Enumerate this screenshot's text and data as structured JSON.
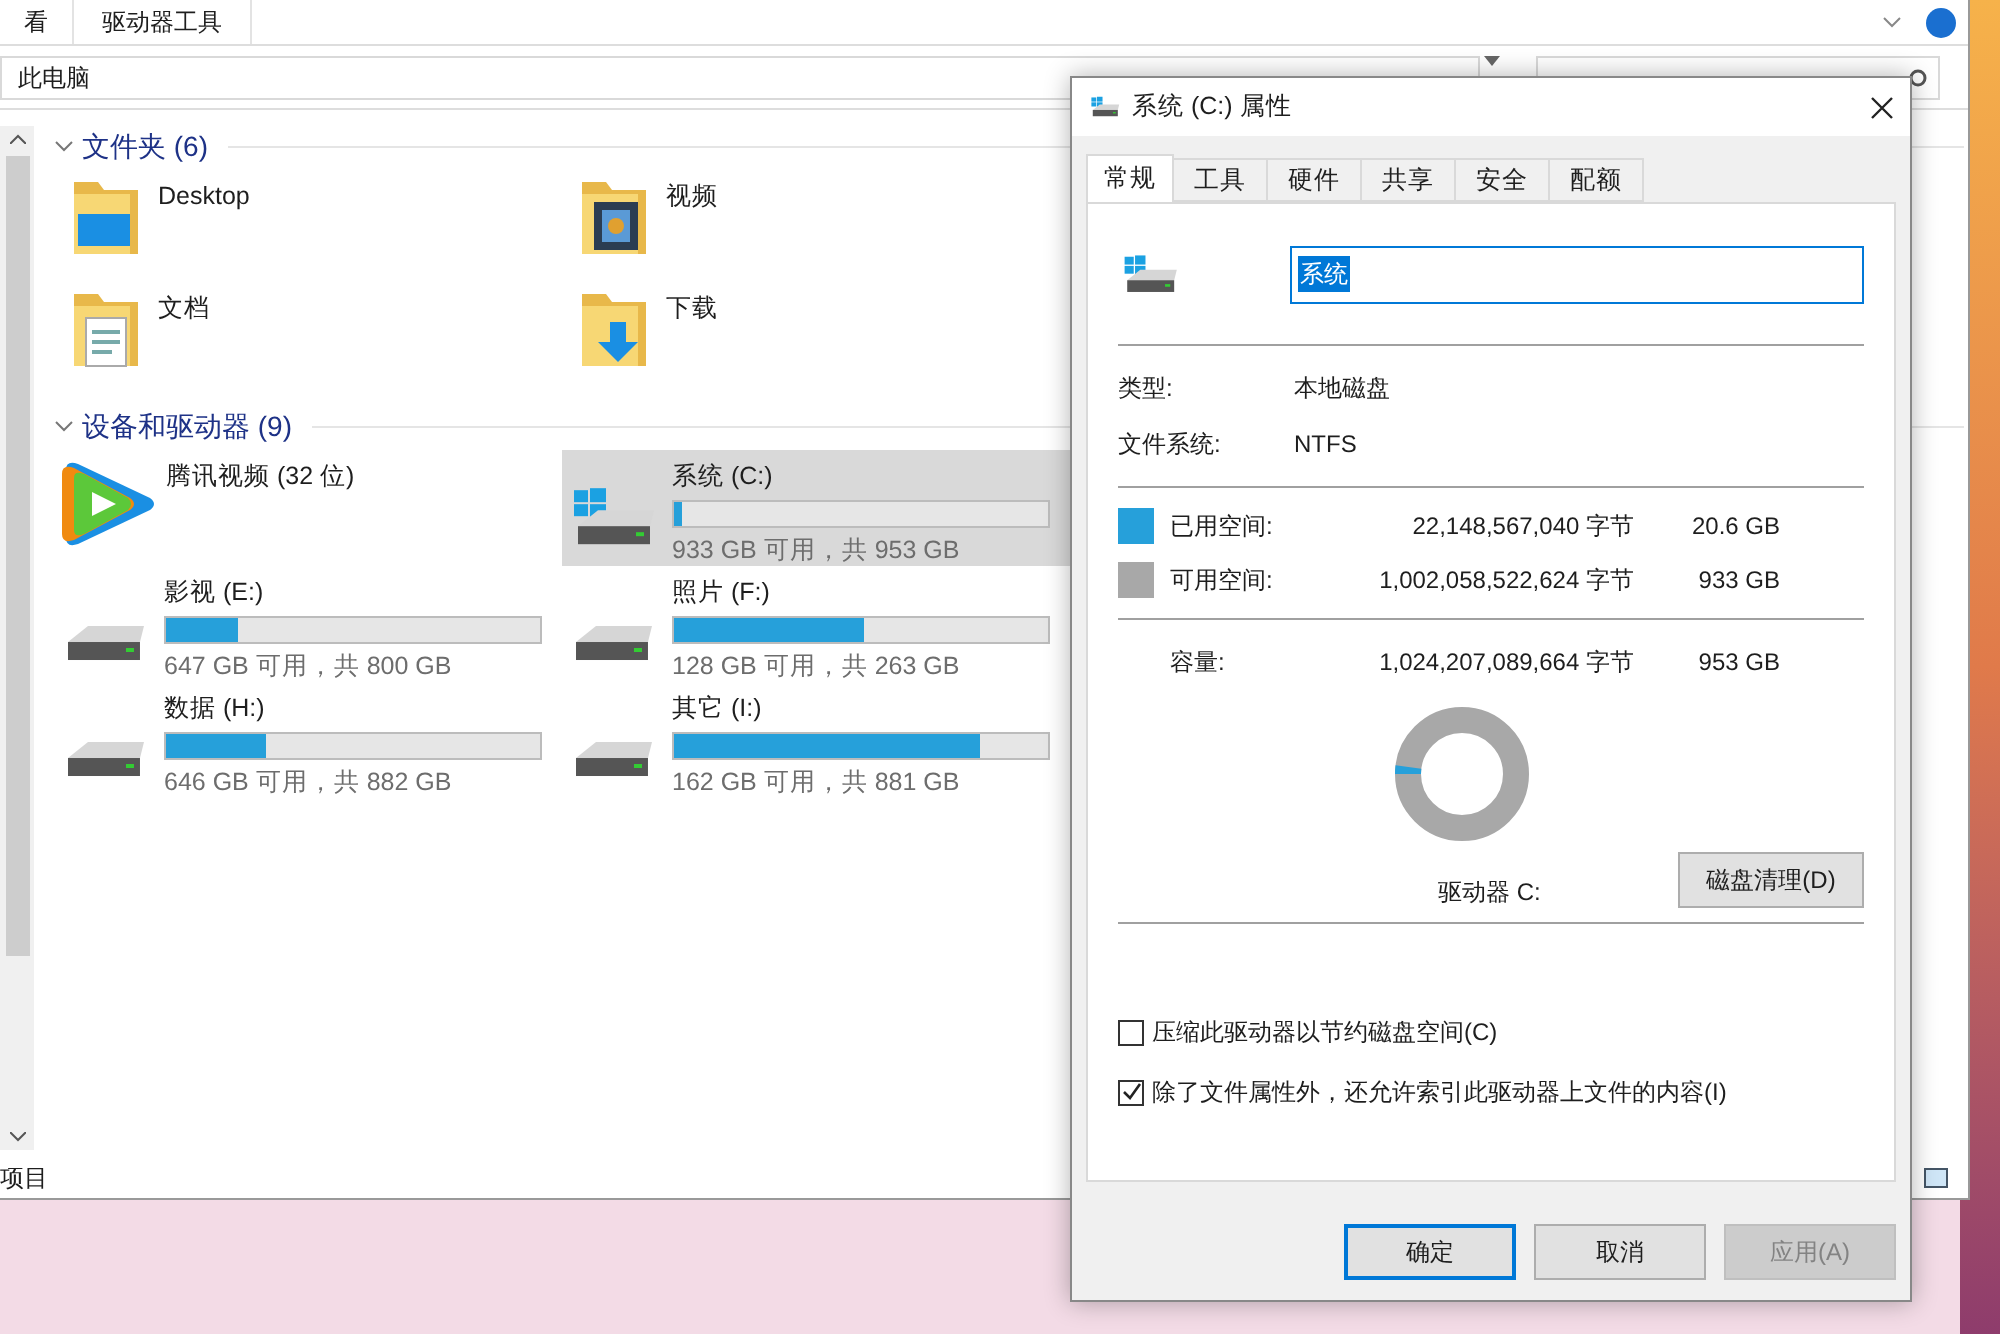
{
  "explorer": {
    "ribbon_tabs": [
      {
        "label": "看"
      },
      {
        "label": "驱动器工具"
      }
    ],
    "address": "此电脑",
    "sections": [
      {
        "title": "文件夹 (6)",
        "expanded": true,
        "items": [
          {
            "kind": "folder",
            "name": "Desktop"
          },
          {
            "kind": "folder",
            "name": "视频"
          },
          {
            "kind": "folder",
            "name": "文档"
          },
          {
            "kind": "folder",
            "name": "下载"
          }
        ]
      },
      {
        "title": "设备和驱动器 (9)",
        "expanded": true,
        "items": [
          {
            "kind": "app",
            "name": "腾讯视频 (32 位)",
            "selected": false
          },
          {
            "kind": "drive",
            "system": true,
            "name": "系统 (C:)",
            "level": 0.021,
            "free": "933 GB 可用，共 953 GB",
            "selected": true
          },
          {
            "kind": "drive",
            "system": false,
            "name": "影视 (E:)",
            "level": 0.19,
            "free": "647 GB 可用，共 800 GB",
            "selected": false
          },
          {
            "kind": "drive",
            "system": false,
            "name": "照片 (F:)",
            "level": 0.51,
            "free": "128 GB 可用，共 263 GB",
            "selected": false
          },
          {
            "kind": "drive",
            "system": false,
            "name": "数据 (H:)",
            "level": 0.27,
            "free": "646 GB 可用，共 882 GB",
            "selected": false
          },
          {
            "kind": "drive",
            "system": false,
            "name": "其它 (I:)",
            "level": 0.82,
            "free": "162 GB 可用，共 881 GB",
            "selected": false
          }
        ]
      }
    ],
    "status": "项目"
  },
  "dialog": {
    "title": "系统 (C:) 属性",
    "tabs": [
      {
        "label": "常规",
        "selected": true
      },
      {
        "label": "工具",
        "selected": false
      },
      {
        "label": "硬件",
        "selected": false
      },
      {
        "label": "共享",
        "selected": false
      },
      {
        "label": "安全",
        "selected": false
      },
      {
        "label": "配额",
        "selected": false
      }
    ],
    "name_value": "系统",
    "info": [
      {
        "label": "类型:",
        "value": "本地磁盘"
      },
      {
        "label": "文件系统:",
        "value": "NTFS"
      }
    ],
    "space": [
      {
        "label": "已用空间:",
        "bytes": "22,148,567,040 字节",
        "size": "20.6 GB",
        "color": "#26a0da"
      },
      {
        "label": "可用空间:",
        "bytes": "1,002,058,522,624 字节",
        "size": "933 GB",
        "color": "#a8a8a8"
      }
    ],
    "capacity": {
      "label": "容量:",
      "bytes": "1,024,207,089,664 字节",
      "size": "953 GB"
    },
    "usage": {
      "level": 0.021
    },
    "drive_label": "驱动器 C:",
    "cleanup_button": "磁盘清理(D)",
    "options": [
      {
        "label": "压缩此驱动器以节约磁盘空间(C)",
        "checked": false
      },
      {
        "label": "除了文件属性外，还允许索引此驱动器上文件的内容(I)",
        "checked": true
      }
    ],
    "buttons": [
      {
        "label": "确定",
        "focused": true,
        "disabled": false
      },
      {
        "label": "取消",
        "focused": false,
        "disabled": false
      },
      {
        "label": "应用(A)",
        "focused": false,
        "disabled": true
      }
    ]
  }
}
